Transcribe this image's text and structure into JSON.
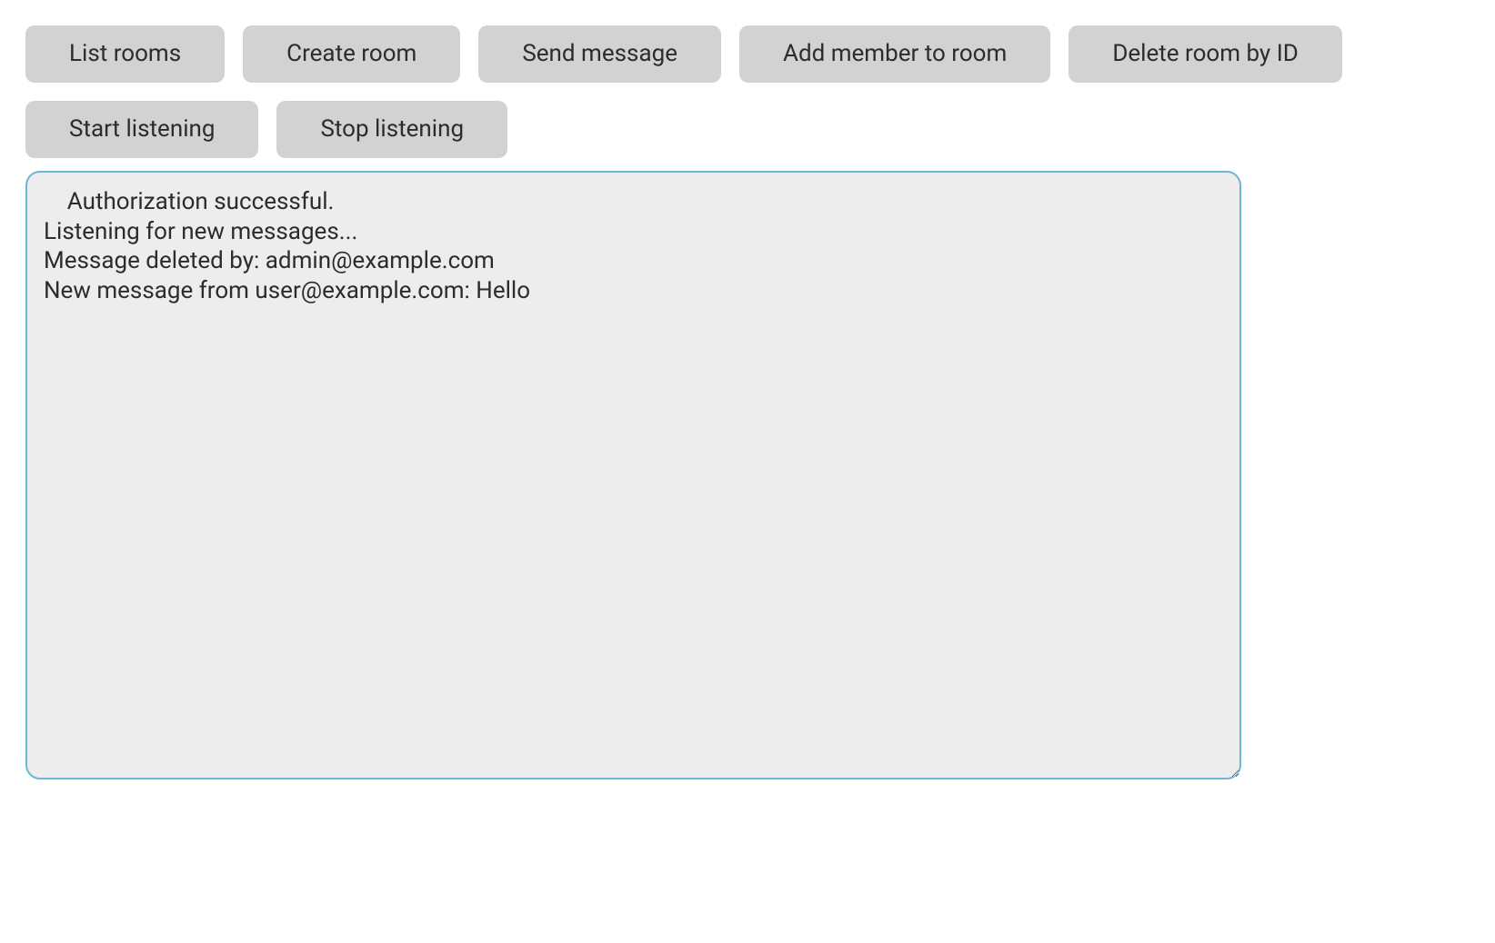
{
  "buttons": {
    "list_rooms": "List rooms",
    "create_room": "Create room",
    "send_message": "Send message",
    "add_member": "Add member to room",
    "delete_room": "Delete room by ID",
    "start_listening": "Start listening",
    "stop_listening": "Stop listening"
  },
  "log": {
    "value": "    Authorization successful.\nListening for new messages...\nMessage deleted by: admin@example.com\nNew message from user@example.com: Hello"
  }
}
